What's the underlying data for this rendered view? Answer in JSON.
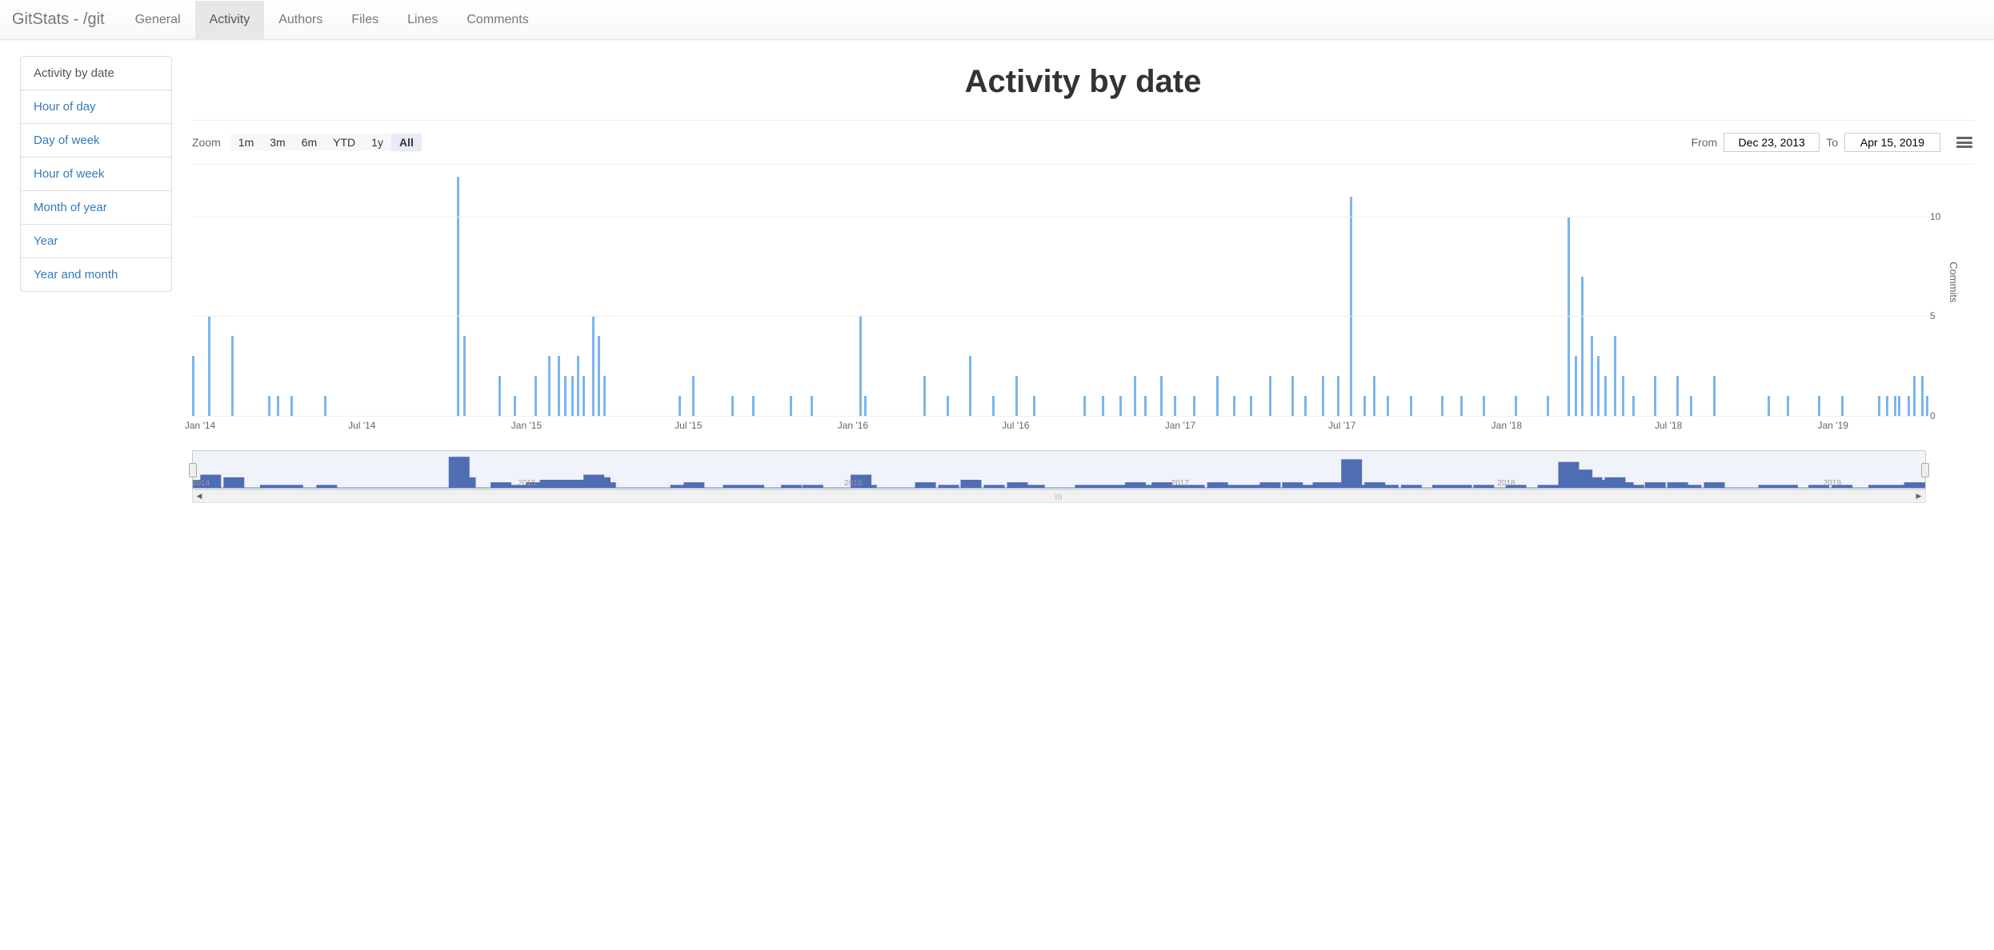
{
  "brand": "GitStats - /git",
  "nav": [
    {
      "label": "General",
      "active": false
    },
    {
      "label": "Activity",
      "active": true
    },
    {
      "label": "Authors",
      "active": false
    },
    {
      "label": "Files",
      "active": false
    },
    {
      "label": "Lines",
      "active": false
    },
    {
      "label": "Comments",
      "active": false
    }
  ],
  "sidebar": [
    {
      "label": "Activity by date",
      "active": true
    },
    {
      "label": "Hour of day",
      "active": false
    },
    {
      "label": "Day of week",
      "active": false
    },
    {
      "label": "Hour of week",
      "active": false
    },
    {
      "label": "Month of year",
      "active": false
    },
    {
      "label": "Year",
      "active": false
    },
    {
      "label": "Year and month",
      "active": false
    }
  ],
  "title": "Activity by date",
  "range": {
    "zoom_label": "Zoom",
    "buttons": [
      {
        "label": "1m",
        "active": false
      },
      {
        "label": "3m",
        "active": false
      },
      {
        "label": "6m",
        "active": false
      },
      {
        "label": "YTD",
        "active": false
      },
      {
        "label": "1y",
        "active": false
      },
      {
        "label": "All",
        "active": true
      }
    ],
    "from_label": "From",
    "from_value": "Dec 23, 2013",
    "to_label": "To",
    "to_value": "Apr 15, 2019"
  },
  "chart_data": {
    "type": "bar",
    "title": "Activity by date",
    "xlabel": "",
    "ylabel": "Commits",
    "ylim": [
      0,
      12
    ],
    "y_ticks": [
      0,
      5,
      10
    ],
    "x_ticks": [
      "Jan '14",
      "Jul '14",
      "Jan '15",
      "Jul '15",
      "Jan '16",
      "Jul '16",
      "Jan '17",
      "Jul '17",
      "Jan '18",
      "Jul '18",
      "Jan '19"
    ],
    "x_range": [
      "2013-12-23",
      "2019-04-15"
    ],
    "series": [
      {
        "name": "Commits",
        "points": [
          {
            "date": "2013-12-23",
            "value": 3
          },
          {
            "date": "2014-01-10",
            "value": 5
          },
          {
            "date": "2014-02-05",
            "value": 4
          },
          {
            "date": "2014-03-18",
            "value": 1
          },
          {
            "date": "2014-03-28",
            "value": 1
          },
          {
            "date": "2014-04-12",
            "value": 1
          },
          {
            "date": "2014-05-20",
            "value": 1
          },
          {
            "date": "2014-10-15",
            "value": 12
          },
          {
            "date": "2014-10-22",
            "value": 4
          },
          {
            "date": "2014-12-01",
            "value": 2
          },
          {
            "date": "2014-12-18",
            "value": 1
          },
          {
            "date": "2015-01-10",
            "value": 2
          },
          {
            "date": "2015-01-25",
            "value": 3
          },
          {
            "date": "2015-02-05",
            "value": 3
          },
          {
            "date": "2015-02-12",
            "value": 2
          },
          {
            "date": "2015-02-20",
            "value": 2
          },
          {
            "date": "2015-02-26",
            "value": 3
          },
          {
            "date": "2015-03-05",
            "value": 2
          },
          {
            "date": "2015-03-15",
            "value": 5
          },
          {
            "date": "2015-03-22",
            "value": 4
          },
          {
            "date": "2015-03-28",
            "value": 2
          },
          {
            "date": "2015-06-20",
            "value": 1
          },
          {
            "date": "2015-07-05",
            "value": 2
          },
          {
            "date": "2015-08-18",
            "value": 1
          },
          {
            "date": "2015-09-10",
            "value": 1
          },
          {
            "date": "2015-10-22",
            "value": 1
          },
          {
            "date": "2015-11-15",
            "value": 1
          },
          {
            "date": "2016-01-08",
            "value": 5
          },
          {
            "date": "2016-01-14",
            "value": 1
          },
          {
            "date": "2016-03-20",
            "value": 2
          },
          {
            "date": "2016-04-15",
            "value": 1
          },
          {
            "date": "2016-05-10",
            "value": 3
          },
          {
            "date": "2016-06-05",
            "value": 1
          },
          {
            "date": "2016-07-01",
            "value": 2
          },
          {
            "date": "2016-07-20",
            "value": 1
          },
          {
            "date": "2016-09-15",
            "value": 1
          },
          {
            "date": "2016-10-05",
            "value": 1
          },
          {
            "date": "2016-10-25",
            "value": 1
          },
          {
            "date": "2016-11-10",
            "value": 2
          },
          {
            "date": "2016-11-22",
            "value": 1
          },
          {
            "date": "2016-12-10",
            "value": 2
          },
          {
            "date": "2016-12-25",
            "value": 1
          },
          {
            "date": "2017-01-15",
            "value": 1
          },
          {
            "date": "2017-02-10",
            "value": 2
          },
          {
            "date": "2017-03-01",
            "value": 1
          },
          {
            "date": "2017-03-20",
            "value": 1
          },
          {
            "date": "2017-04-10",
            "value": 2
          },
          {
            "date": "2017-05-05",
            "value": 2
          },
          {
            "date": "2017-05-20",
            "value": 1
          },
          {
            "date": "2017-06-08",
            "value": 2
          },
          {
            "date": "2017-06-25",
            "value": 2
          },
          {
            "date": "2017-07-10",
            "value": 11
          },
          {
            "date": "2017-07-25",
            "value": 1
          },
          {
            "date": "2017-08-05",
            "value": 2
          },
          {
            "date": "2017-08-20",
            "value": 1
          },
          {
            "date": "2017-09-15",
            "value": 1
          },
          {
            "date": "2017-10-20",
            "value": 1
          },
          {
            "date": "2017-11-10",
            "value": 1
          },
          {
            "date": "2017-12-05",
            "value": 1
          },
          {
            "date": "2018-01-10",
            "value": 1
          },
          {
            "date": "2018-02-15",
            "value": 1
          },
          {
            "date": "2018-03-10",
            "value": 10
          },
          {
            "date": "2018-03-18",
            "value": 3
          },
          {
            "date": "2018-03-25",
            "value": 7
          },
          {
            "date": "2018-04-05",
            "value": 4
          },
          {
            "date": "2018-04-12",
            "value": 3
          },
          {
            "date": "2018-04-20",
            "value": 2
          },
          {
            "date": "2018-05-01",
            "value": 4
          },
          {
            "date": "2018-05-10",
            "value": 2
          },
          {
            "date": "2018-05-22",
            "value": 1
          },
          {
            "date": "2018-06-15",
            "value": 2
          },
          {
            "date": "2018-07-10",
            "value": 2
          },
          {
            "date": "2018-07-25",
            "value": 1
          },
          {
            "date": "2018-08-20",
            "value": 2
          },
          {
            "date": "2018-10-20",
            "value": 1
          },
          {
            "date": "2018-11-10",
            "value": 1
          },
          {
            "date": "2018-12-15",
            "value": 1
          },
          {
            "date": "2019-01-10",
            "value": 1
          },
          {
            "date": "2019-02-20",
            "value": 1
          },
          {
            "date": "2019-03-01",
            "value": 1
          },
          {
            "date": "2019-03-10",
            "value": 1
          },
          {
            "date": "2019-03-15",
            "value": 1
          },
          {
            "date": "2019-03-25",
            "value": 1
          },
          {
            "date": "2019-04-01",
            "value": 2
          },
          {
            "date": "2019-04-10",
            "value": 2
          },
          {
            "date": "2019-04-15",
            "value": 1
          }
        ]
      }
    ],
    "navigator_years": [
      "2014",
      "2015",
      "2016",
      "2017",
      "2018",
      "2019"
    ]
  }
}
